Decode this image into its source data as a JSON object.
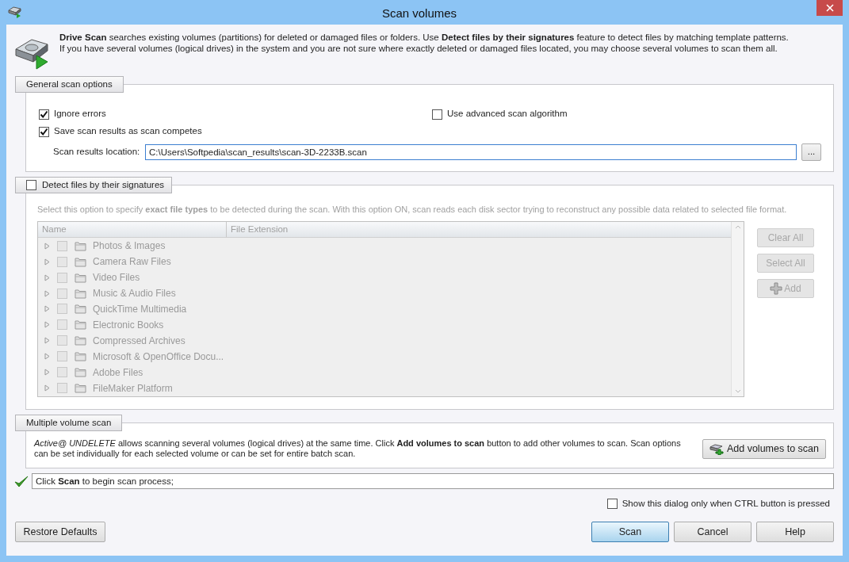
{
  "window": {
    "title": "Scan volumes"
  },
  "intro": [
    "**Drive Scan** searches existing volumes (partitions) for deleted or damaged files or folders. Use **Detect files by their signatures** feature to detect files by matching template patterns.",
    "If you have several volumes (logical drives) in the system and you are not sure where exactly deleted or damaged files located, you may choose several volumes to scan them all."
  ],
  "general_options": {
    "title": "General scan options",
    "options": [
      {
        "label": "Ignore errors",
        "checked": true
      },
      {
        "label": "Use advanced scan algorithm",
        "checked": false
      },
      {
        "label": "Save scan results as scan competes",
        "checked": true
      }
    ],
    "location_label": "Scan results location:",
    "location_value": "C:\\Users\\Softpedia\\scan_results\\scan-3D-2233B.scan",
    "browse_button": "..."
  },
  "signatures": {
    "title": "Detect files by their signatures",
    "checked": false,
    "disabled": true,
    "description": "Select this option to specify **exact file types** to be detected during the scan. With this option ON, scan reads each disk sector trying to reconstruct any possible data related to selected file format.",
    "columns": [
      "Name",
      "File Extension"
    ],
    "items": [
      {
        "label": "Photos & Images",
        "checked": false
      },
      {
        "label": "Camera Raw Files",
        "checked": false
      },
      {
        "label": "Video Files",
        "checked": false
      },
      {
        "label": "Music & Audio Files",
        "checked": false
      },
      {
        "label": "QuickTime Multimedia",
        "checked": false
      },
      {
        "label": "Electronic Books",
        "checked": false
      },
      {
        "label": "Compressed Archives",
        "checked": false
      },
      {
        "label": "Microsoft & OpenOffice Docu...",
        "checked": false
      },
      {
        "label": "Adobe Files",
        "checked": false
      },
      {
        "label": "FileMaker Platform",
        "checked": false
      }
    ],
    "buttons": [
      {
        "label": "Clear All",
        "kind": "text"
      },
      {
        "label": "Select All",
        "kind": "text"
      },
      {
        "label": "Add",
        "kind": "add"
      }
    ]
  },
  "multiple_scan": {
    "title": "Multiple volume scan",
    "description": "*Active@ UNDELETE* allows scanning several volumes (logical drives) at the same time. Click **Add volumes to scan** button to add other volumes to scan. Scan options can be set individually for each selected volume or can be set for entire batch scan.",
    "button": "Add volumes to scan"
  },
  "status": "Click **Scan** to begin scan process;",
  "ctrl_option": {
    "label": "Show this dialog only when CTRL button is pressed",
    "checked": false
  },
  "restore_button": "Restore Defaults",
  "buttons": [
    {
      "label": "Scan",
      "default": true
    },
    {
      "label": "Cancel",
      "default": false
    },
    {
      "label": "Help",
      "default": false
    }
  ]
}
